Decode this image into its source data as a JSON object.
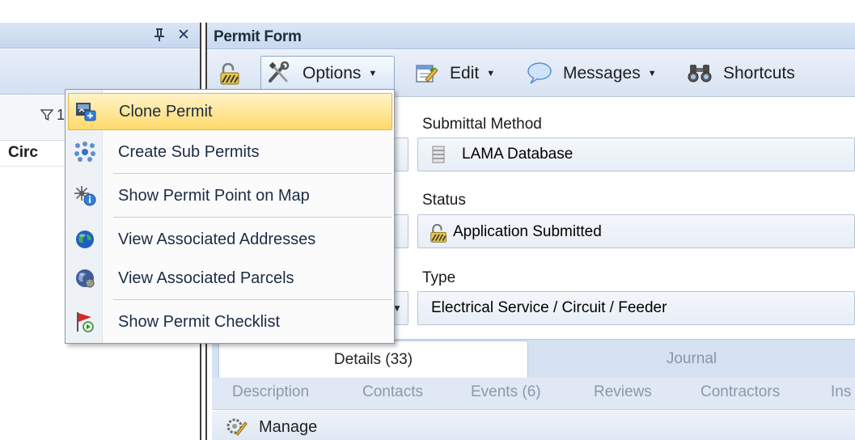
{
  "left_pane": {
    "column_header": "Circ",
    "filter_glyph": "1"
  },
  "form": {
    "title": "Permit Form",
    "toolbar": {
      "options_label": "Options",
      "edit_label": "Edit",
      "messages_label": "Messages",
      "shortcuts_label": "Shortcuts"
    },
    "fields": {
      "submittal_method_label": "Submittal Method",
      "submittal_method_value": "LAMA Database",
      "status_label": "Status",
      "status_value": "Application Submitted",
      "type_label": "Type",
      "type_value": "Electrical Service / Circuit / Feeder"
    },
    "tabs": [
      {
        "label": "Details (33)",
        "active": true
      },
      {
        "label": "Journal",
        "active": false
      }
    ],
    "subtabs": [
      "Description",
      "Contacts",
      "Events (6)",
      "Reviews",
      "Contractors",
      "Ins"
    ],
    "manage_label": "Manage"
  },
  "options_menu": {
    "items": [
      {
        "label": "Clone Permit",
        "icon": "clone-permit-icon",
        "highlighted": true
      },
      {
        "label": "Create Sub Permits",
        "icon": "sub-permits-icon",
        "highlighted": false
      },
      {
        "label": "Show Permit Point on Map",
        "icon": "map-point-icon",
        "highlighted": false
      },
      {
        "label": "View Associated Addresses",
        "icon": "globe-addresses-icon",
        "highlighted": false
      },
      {
        "label": "View Associated Parcels",
        "icon": "globe-parcels-icon",
        "highlighted": false
      },
      {
        "label": "Show Permit Checklist",
        "icon": "checklist-flag-icon",
        "highlighted": false
      }
    ]
  },
  "colors": {
    "menu_highlight": "#ffd96b",
    "pane_header": "#c9d9ef",
    "accent_blue": "#1f5fbf"
  }
}
